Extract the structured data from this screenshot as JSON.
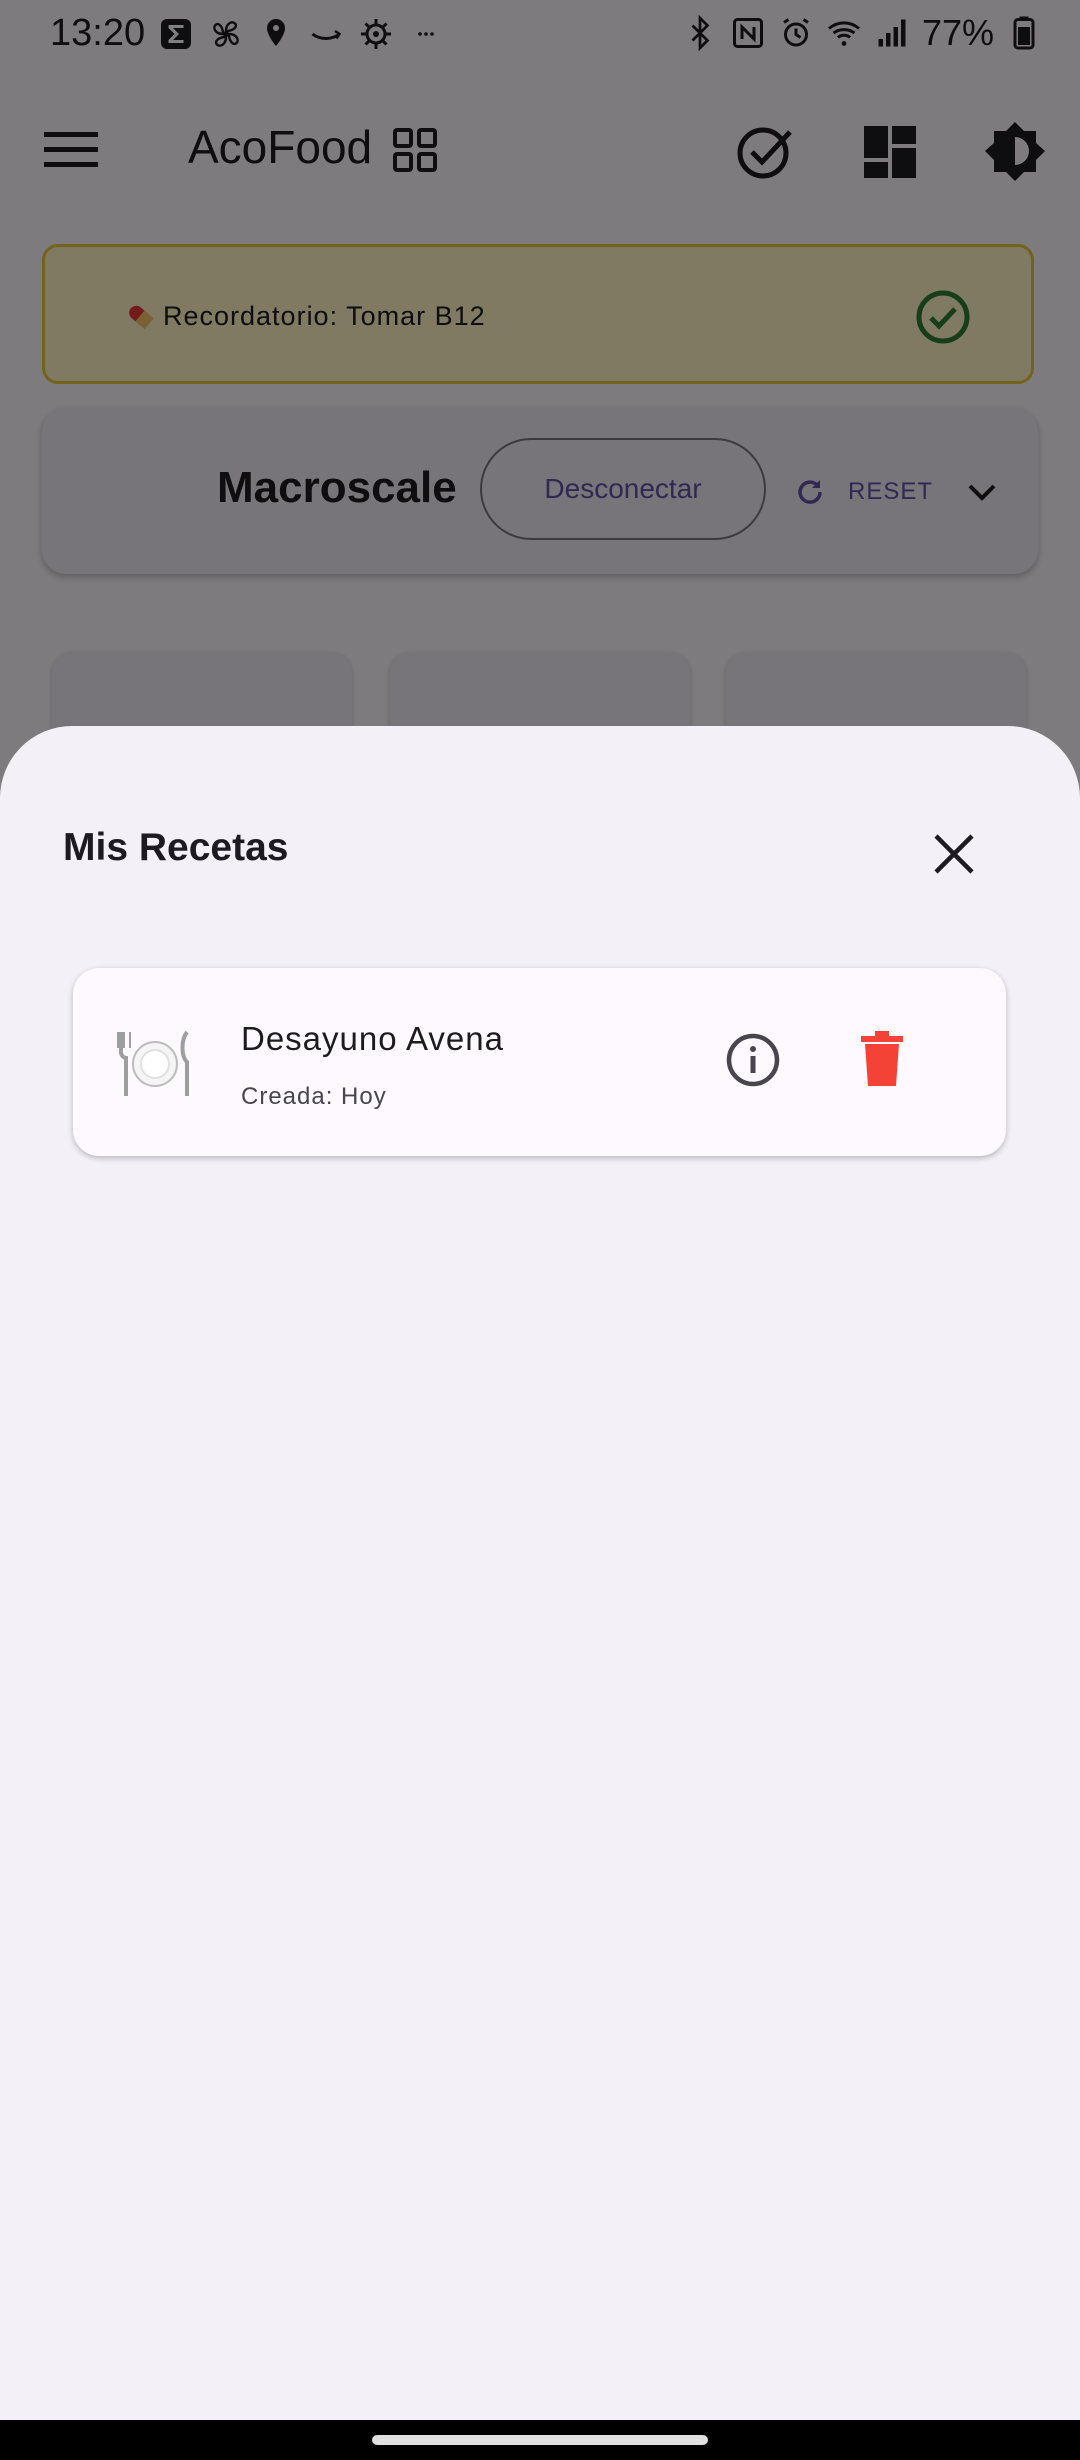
{
  "status_bar": {
    "time": "13:20",
    "battery": "77%",
    "left_icons": [
      "sigma-icon",
      "fan-icon",
      "location-icon",
      "amazon-icon",
      "settings-icon",
      "more-icon"
    ],
    "right_icons": [
      "bluetooth-icon",
      "nfc-icon",
      "alarm-icon",
      "wifi-icon",
      "signal-icon",
      "battery-icon"
    ]
  },
  "app_bar": {
    "title": "AcoFood",
    "icons": [
      "menu-icon",
      "grid-icon",
      "check-circle-icon",
      "dashboard-icon",
      "brightness-icon"
    ]
  },
  "reminder": {
    "text": "Recordatorio: Tomar B12",
    "icon": "pill-icon"
  },
  "scale_card": {
    "title": "Macroscale",
    "disconnect_label": "Desconectar",
    "reset_label": "RESET"
  },
  "sheet": {
    "title": "Mis Recetas",
    "recipes": [
      {
        "name": "Desayuno Avena",
        "created": "Creada: Hoy",
        "icon": "plate-icon"
      }
    ]
  },
  "colors": {
    "accent": "#6750a4",
    "delete": "#f44336",
    "success": "#2e7d32",
    "reminder_bg": "#fff5c2",
    "sheet_bg": "#f4f0f8"
  }
}
